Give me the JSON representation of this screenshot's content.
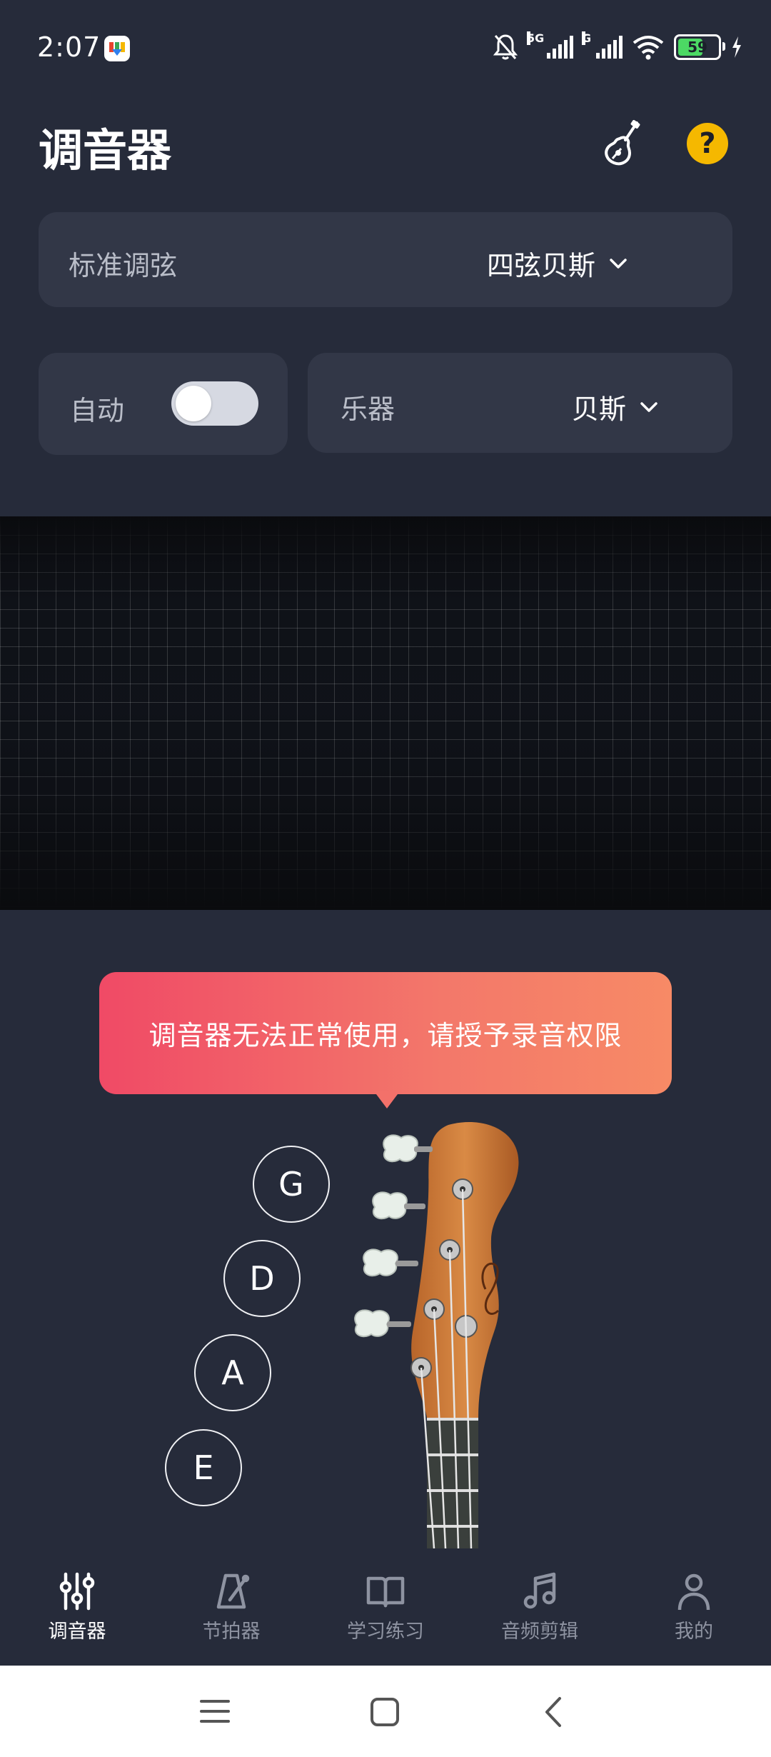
{
  "status_bar": {
    "time": "2:07",
    "network_1": "5G",
    "network_2": "G",
    "battery": "59"
  },
  "header": {
    "title": "调音器",
    "guitar_icon": "guitar-icon",
    "help_icon": "help-icon",
    "help_glyph": "?"
  },
  "tuning": {
    "label": "标准调弦",
    "value": "四弦贝斯"
  },
  "auto": {
    "label": "自动",
    "enabled": false
  },
  "instrument": {
    "label": "乐器",
    "value": "贝斯"
  },
  "permission_message": "调音器无法正常使用，请授予录音权限",
  "strings": [
    "G",
    "D",
    "A",
    "E"
  ],
  "bottom_nav": [
    {
      "label": "调音器",
      "icon": "tuner-sliders-icon",
      "active": true
    },
    {
      "label": "节拍器",
      "icon": "metronome-icon",
      "active": false
    },
    {
      "label": "学习练习",
      "icon": "book-icon",
      "active": false
    },
    {
      "label": "音频剪辑",
      "icon": "music-note-icon",
      "active": false
    },
    {
      "label": "我的",
      "icon": "person-icon",
      "active": false
    }
  ],
  "colors": {
    "background": "#262b3a",
    "card": "#323747",
    "accent_yellow": "#f5b800",
    "bubble_start": "#f04a66",
    "bubble_end": "#f78a66"
  }
}
